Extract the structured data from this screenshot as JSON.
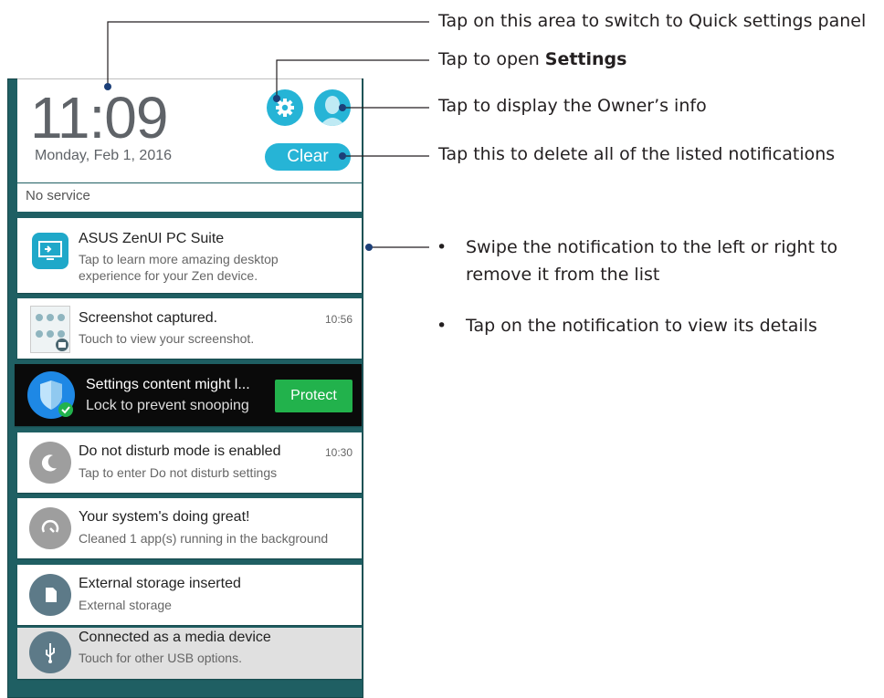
{
  "header": {
    "time": "11:09",
    "date": "Monday, Feb 1, 2016",
    "clear_label": "Clear",
    "no_service": "No service"
  },
  "notifications": [
    {
      "title": "ASUS ZenUI PC Suite",
      "sub1": "Tap to learn more amazing desktop",
      "sub2": "experience for your Zen device.",
      "icon": "monitor-icon",
      "color": "#1fa8c9"
    },
    {
      "title": "Screenshot captured.",
      "sub": "Touch to view your screenshot.",
      "time": "10:56",
      "icon": "screenshot-thumbnail-icon"
    },
    {
      "title": "Settings content might l...",
      "sub": "Lock to prevent snooping",
      "button": "Protect",
      "icon": "shield-icon",
      "color": "#1e88e5"
    },
    {
      "title": "Do not disturb mode is enabled",
      "sub": "Tap to enter Do not disturb settings",
      "time": "10:30",
      "icon": "moon-icon",
      "color": "#9e9e9e"
    },
    {
      "title": "Your system's doing great!",
      "sub": "Cleaned 1 app(s) running in the background",
      "icon": "cleanup-icon",
      "color": "#9e9e9e"
    },
    {
      "title": "External storage inserted",
      "sub": "External storage",
      "icon": "sd-card-icon",
      "color": "#5d7a88"
    },
    {
      "title": "Connected as a media device",
      "sub": "Touch for other USB options.",
      "icon": "usb-icon",
      "color": "#5d7a88"
    }
  ],
  "annotations": {
    "quick_settings": "Tap on this area to switch to Quick settings panel",
    "settings_prefix": "Tap to open ",
    "settings_bold": "Settings",
    "owner": "Tap to display the Owner’s info",
    "clear": "Tap this to delete all of the listed notifications",
    "bullet1_line1": "Swipe the notification to the left or right to",
    "bullet1_line2": "remove it from the list",
    "bullet2": "Tap on the notification to view its details",
    "bullet_char": "•"
  },
  "colors": {
    "accent": "#26b4d6",
    "protect": "#22b24c",
    "wallpaper": "#1f5f63"
  }
}
